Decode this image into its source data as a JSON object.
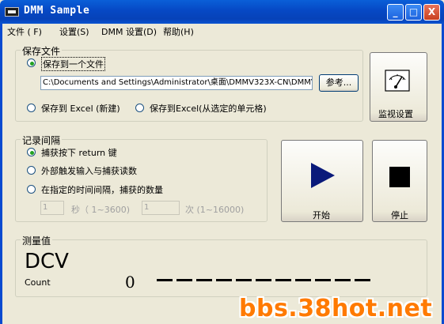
{
  "window": {
    "title": "DMM Sample",
    "minimize": "_",
    "maximize": "□",
    "close": "X"
  },
  "menu": [
    {
      "label": "文件 ( F)"
    },
    {
      "label": "设置(S)"
    },
    {
      "label": "DMM 设置(D)"
    },
    {
      "label": "帮助(H)"
    }
  ],
  "save_group": {
    "title": "保存文件",
    "option_file": "保存到一个文件",
    "path_value": "C:\\Documents and Settings\\Administrator\\桌面\\DMMV323X-CN\\DMMV",
    "browse_label": "参考...",
    "option_excel_new": "保存到 Excel (新建)",
    "option_excel_cell": "保存到Excel(从选定的单元格)",
    "selected": "file"
  },
  "monitor_button": {
    "label": "监视设置"
  },
  "record_group": {
    "title": "记录间隔",
    "option_return": "捕获按下 return 键",
    "option_trigger": "外部触发输入与捕获读数",
    "option_interval": "在指定的时间间隔，捕获的数量",
    "interval_value": "1",
    "interval_unit": "秒（ 1~3600)",
    "count_value": "1",
    "count_unit": "次 (1~16000)",
    "selected": "return"
  },
  "start_button": {
    "label": "开始",
    "icon": "play-icon",
    "icon_color": "#0a1a7a"
  },
  "stop_button": {
    "label": "停止",
    "icon": "stop-icon",
    "icon_color": "#000000"
  },
  "measure_group": {
    "title": "测量值",
    "mode": "DCV",
    "count_label": "Count",
    "count_value": "0"
  },
  "watermark": {
    "text": "bbs.38hot.net",
    "color": "#ff7a00"
  }
}
